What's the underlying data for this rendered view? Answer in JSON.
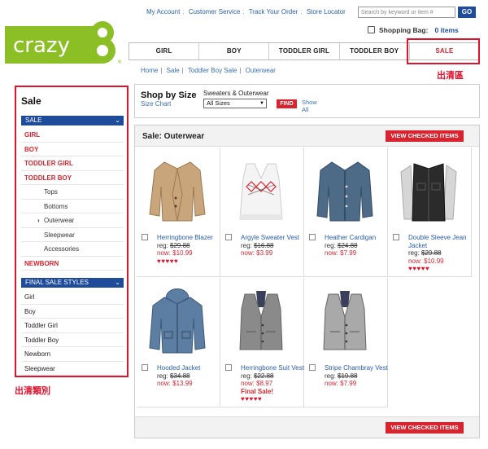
{
  "header": {
    "logo_text": "crazy 8",
    "links": [
      "My Account",
      "Customer Service",
      "Track Your Order",
      "Store Locator"
    ],
    "search_placeholder": "Search by keyword or item #",
    "go_label": "GO",
    "bag_label": "Shopping Bag:",
    "bag_items": "0 items"
  },
  "nav": {
    "tabs": [
      "GIRL",
      "BOY",
      "TODDLER GIRL",
      "TODDLER BOY",
      "SALE"
    ]
  },
  "annotations": {
    "sale_area": "出清區",
    "category": "出清類別"
  },
  "breadcrumb": [
    "Home",
    "Sale",
    "Toddler Boy Sale",
    "Outerwear"
  ],
  "sidebar": {
    "title": "Sale",
    "sale_bar": "SALE",
    "sale_items": [
      {
        "label": "GIRL",
        "style": "red"
      },
      {
        "label": "BOY",
        "style": "red"
      },
      {
        "label": "TODDLER GIRL",
        "style": "red"
      },
      {
        "label": "TODDLER BOY",
        "style": "red"
      },
      {
        "label": "Tops",
        "style": "sub"
      },
      {
        "label": "Bottoms",
        "style": "sub"
      },
      {
        "label": "Outerwear",
        "style": "sub cur"
      },
      {
        "label": "Sleepwear",
        "style": "sub"
      },
      {
        "label": "Accessories",
        "style": "sub"
      },
      {
        "label": "NEWBORN",
        "style": "red"
      }
    ],
    "final_bar": "FINAL SALE STYLES",
    "final_items": [
      "Girl",
      "Boy",
      "Toddler Girl",
      "Toddler Boy",
      "Newborn",
      "Sleepwear"
    ]
  },
  "shop_by_size": {
    "title": "Shop by Size",
    "size_chart": "Size Chart",
    "category": "Sweaters & Outerwear",
    "selected": "All Sizes",
    "find": "FIND",
    "show_all": "Show All"
  },
  "grid": {
    "title": "Sale: Outerwear",
    "view_checked": "VIEW CHECKED ITEMS",
    "products": [
      {
        "name": "Herringbone Blazer",
        "reg": "reg: ",
        "reg_price": "$29.88",
        "now": "now: $10.99",
        "final": "",
        "stars": "♥♥♥♥♥",
        "color": "#c8a57a",
        "kind": "blazer"
      },
      {
        "name": "Argyle Sweater Vest",
        "reg": "reg: ",
        "reg_price": "$16.88",
        "now": "now: $3.99",
        "final": "",
        "stars": "",
        "color": "#f4f4f4",
        "kind": "vest-argyle"
      },
      {
        "name": "Heather Cardigan",
        "reg": "reg: ",
        "reg_price": "$24.88",
        "now": "now: $7.99",
        "final": "",
        "stars": "",
        "color": "#4d6a87",
        "kind": "cardigan"
      },
      {
        "name": "Double Sleeve Jean Jacket",
        "reg": "reg: ",
        "reg_price": "$29.88",
        "now": "now: $10.99",
        "final": "",
        "stars": "♥♥♥♥♥",
        "color": "#2b2b2b",
        "kind": "jacket-two"
      },
      {
        "name": "Hooded Jacket",
        "reg": "reg: ",
        "reg_price": "$34.88",
        "now": "now: $13.99",
        "final": "",
        "stars": "",
        "color": "#5d7ea3",
        "kind": "hooded"
      },
      {
        "name": "Herringbone Suit Vest",
        "reg": "reg: ",
        "reg_price": "$22.88",
        "now": "now: $8.97",
        "final": "Final Sale!",
        "stars": "♥♥♥♥♥",
        "color": "#8a8a8a",
        "kind": "vest"
      },
      {
        "name": "Stripe Chambray Vest",
        "reg": "reg: ",
        "reg_price": "$19.88",
        "now": "now: $7.99",
        "final": "",
        "stars": "",
        "color": "#a9a9a9",
        "kind": "vest"
      }
    ]
  },
  "colors": {
    "accent": "#d9232e",
    "nav_blue": "#1e4c9a",
    "link": "#2a5ea8",
    "logo_green": "#8cbf26",
    "highlight": "#e0122c"
  }
}
